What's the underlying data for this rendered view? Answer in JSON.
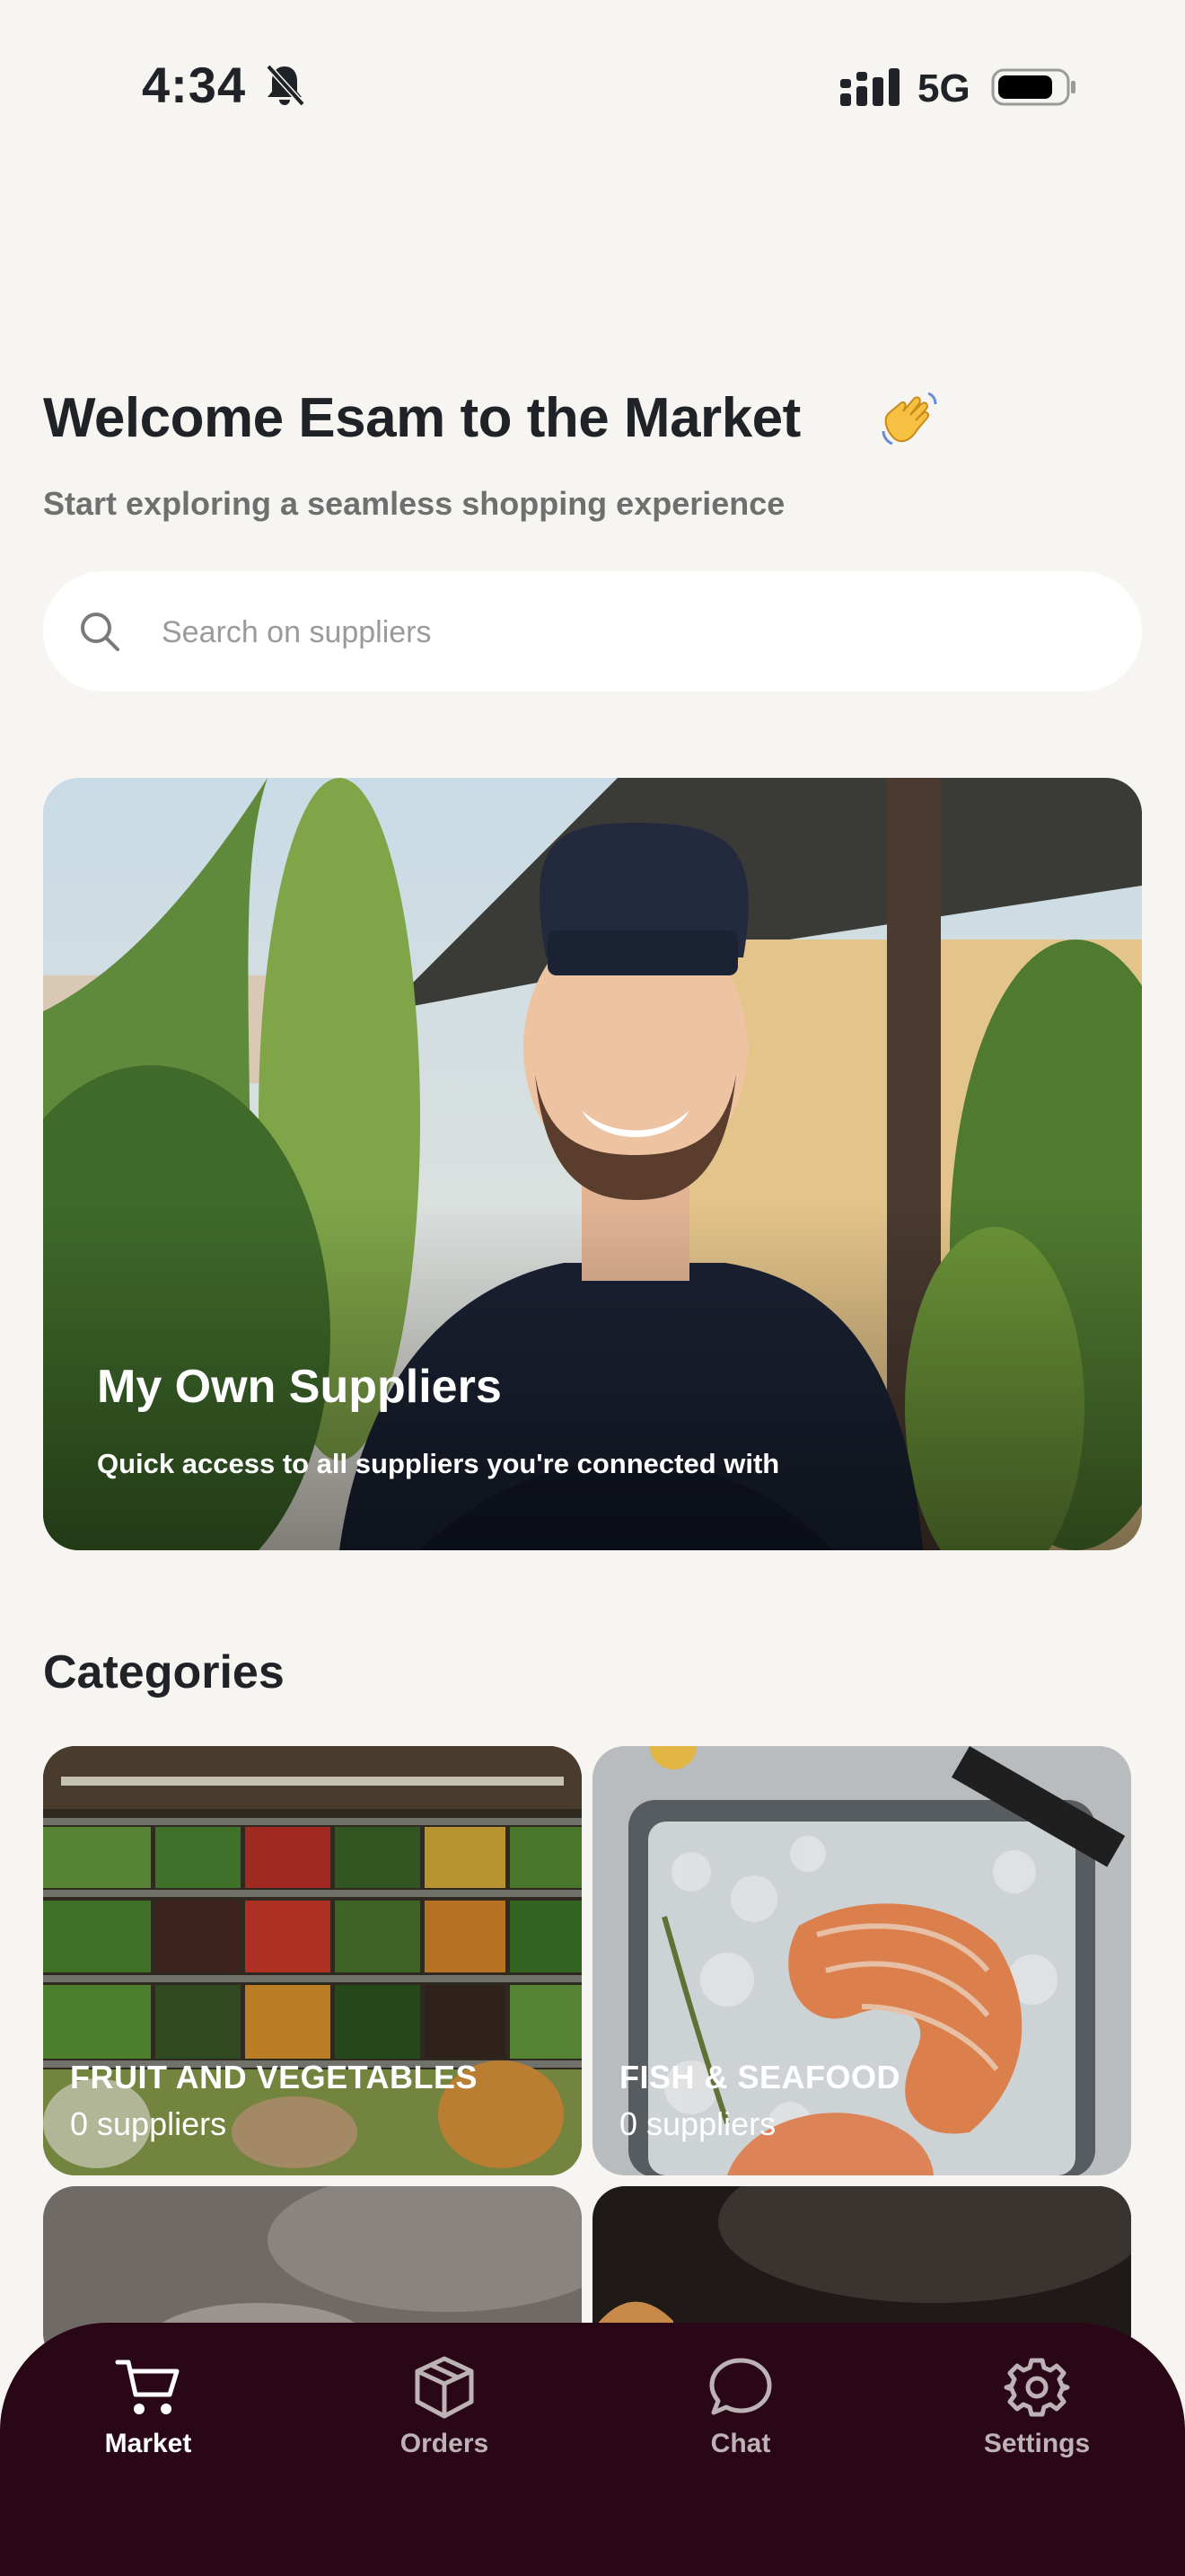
{
  "status_bar": {
    "time": "4:34",
    "network": "5G",
    "icons": [
      "bell-slash-icon",
      "signal-icon",
      "battery-icon"
    ]
  },
  "welcome": {
    "title": "Welcome Esam to the Market",
    "emoji_icon": "waving-hand-icon",
    "subtitle": "Start exploring a seamless shopping experience"
  },
  "search": {
    "placeholder": "Search on suppliers",
    "icon": "search-icon"
  },
  "hero": {
    "title": "My Own Suppliers",
    "subtitle": "Quick access to all suppliers you're connected with"
  },
  "categories": {
    "title": "Categories",
    "items": [
      {
        "name": "FRUIT AND VEGETABLES",
        "count": "0 suppliers"
      },
      {
        "name": "FISH & SEAFOOD",
        "count": "0 suppliers"
      }
    ]
  },
  "tab_bar": {
    "items": [
      {
        "label": "Market",
        "icon": "cart-icon",
        "active": true
      },
      {
        "label": "Orders",
        "icon": "box-icon",
        "active": false
      },
      {
        "label": "Chat",
        "icon": "chat-bubble-icon",
        "active": false
      },
      {
        "label": "Settings",
        "icon": "gear-icon",
        "active": false
      }
    ]
  },
  "colors": {
    "background": "#f6f5f1",
    "tab_bar": "#2a0716",
    "text": "#1f2227"
  }
}
